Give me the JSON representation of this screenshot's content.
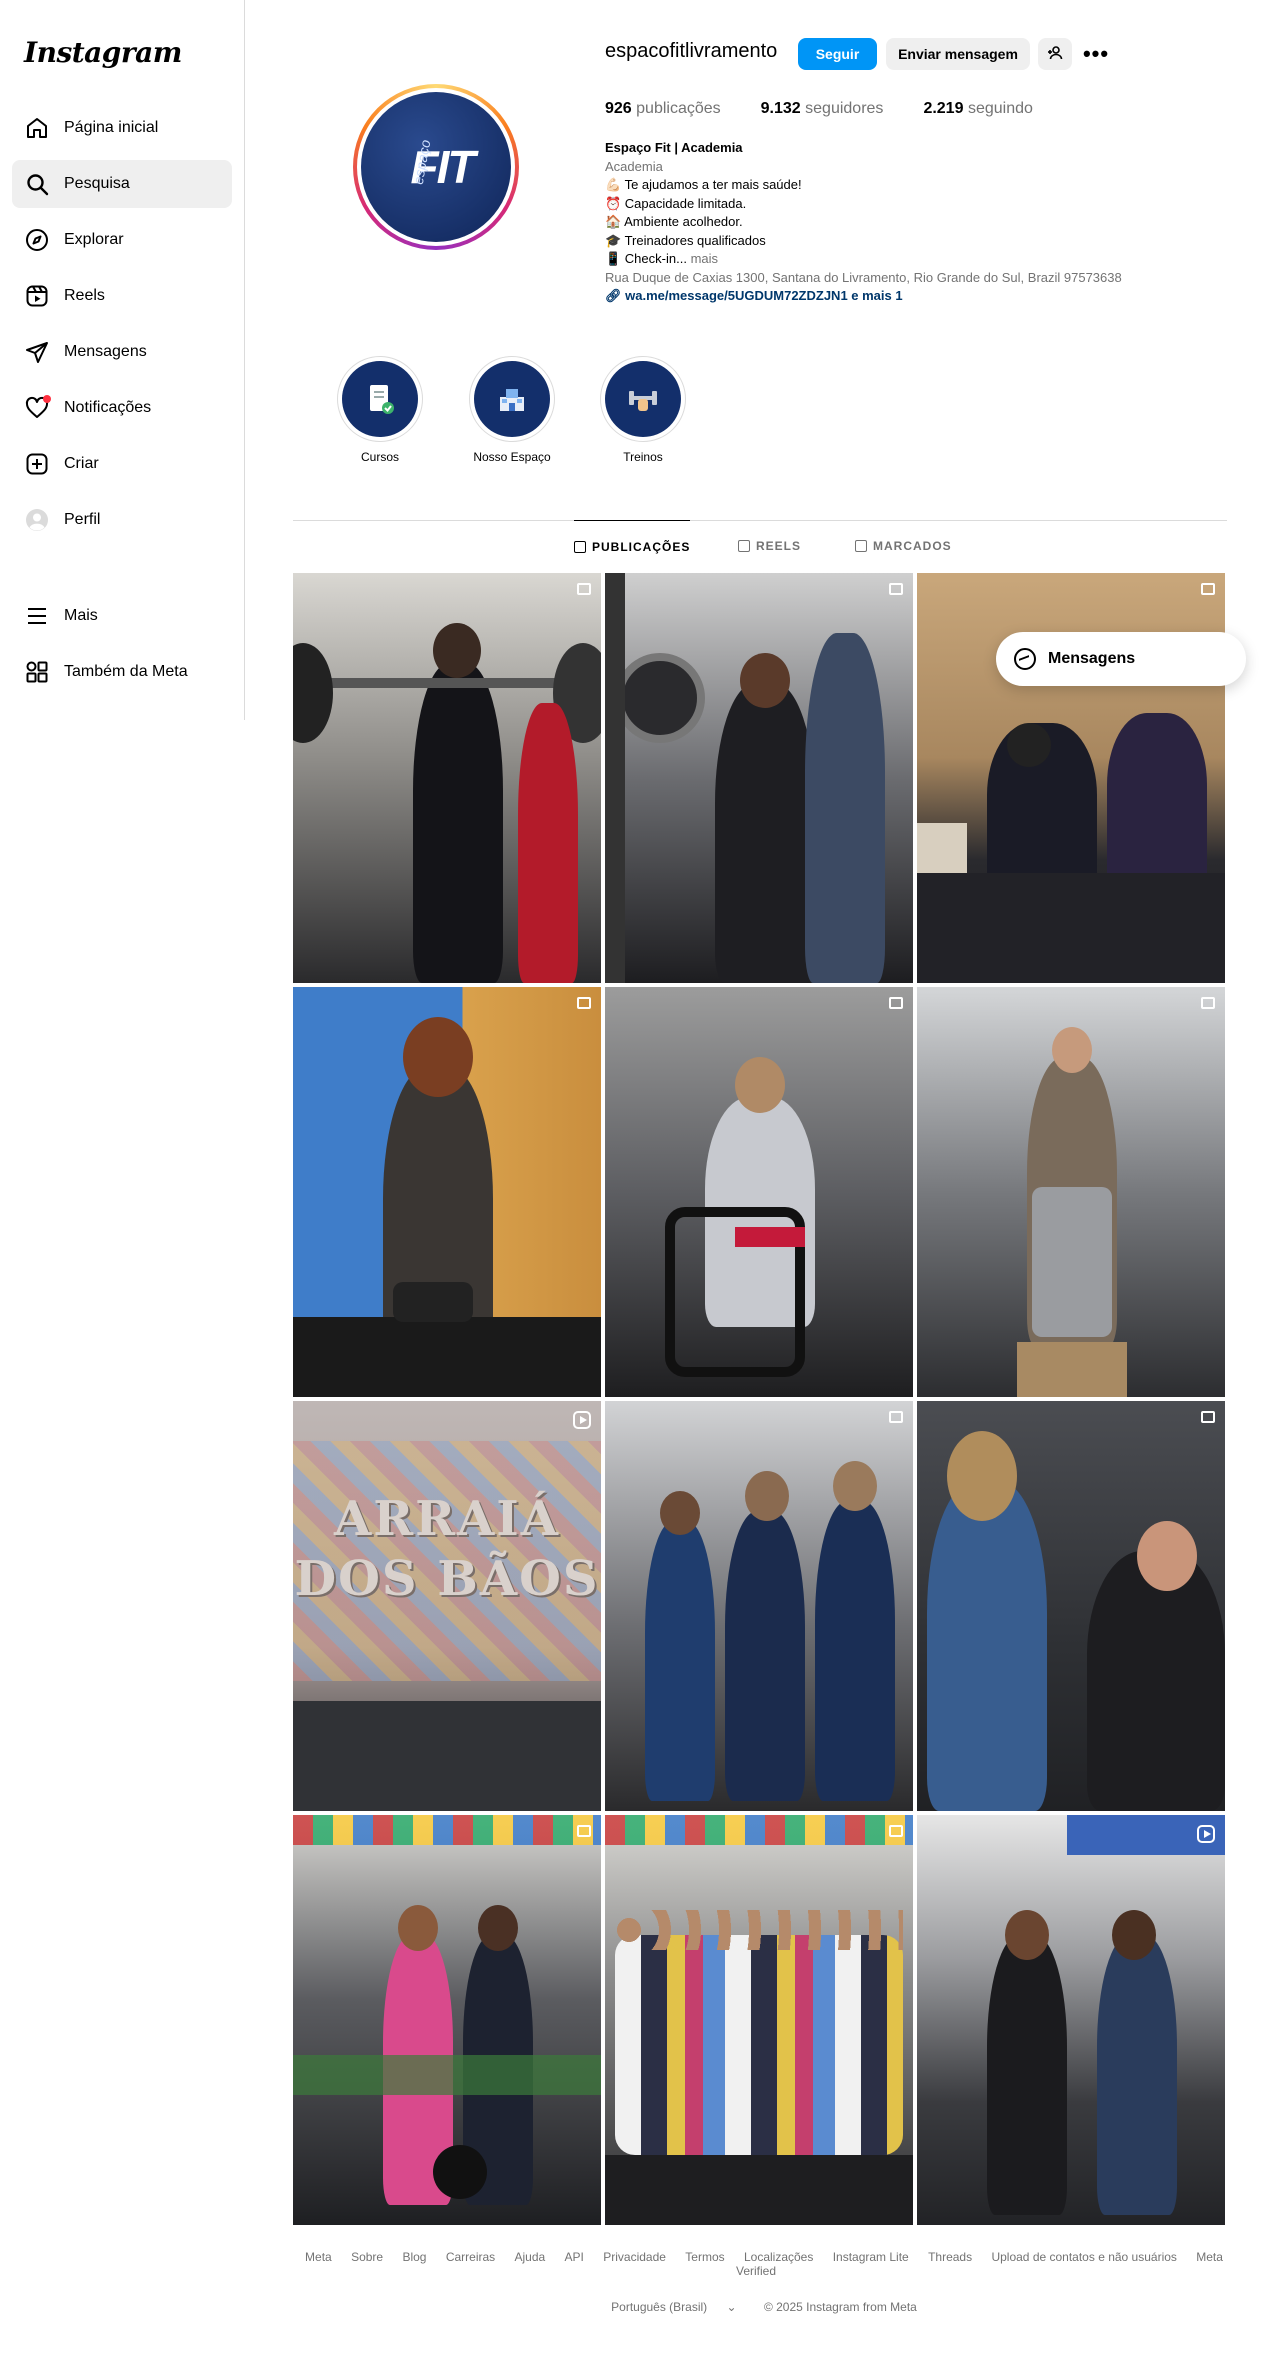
{
  "app": {
    "brand": "Instagram"
  },
  "sidebar": {
    "items": [
      {
        "label": "Página inicial",
        "icon": "home-icon"
      },
      {
        "label": "Pesquisa",
        "icon": "search-icon",
        "active": true
      },
      {
        "label": "Explorar",
        "icon": "compass-icon"
      },
      {
        "label": "Reels",
        "icon": "reels-icon"
      },
      {
        "label": "Mensagens",
        "icon": "send-icon"
      },
      {
        "label": "Notificações",
        "icon": "heart-icon"
      },
      {
        "label": "Criar",
        "icon": "plus-square-icon"
      },
      {
        "label": "Perfil",
        "icon": "profile-avatar-icon"
      }
    ],
    "bottom": [
      {
        "label": "Mais",
        "icon": "menu-icon"
      },
      {
        "label": "Também da Meta",
        "icon": "meta-apps-icon"
      }
    ]
  },
  "profile": {
    "username": "espacofitlivramento",
    "follow_label": "Seguir",
    "message_label": "Enviar mensagem",
    "avatar_text_small": "espaço",
    "avatar_text_big": "FIT",
    "stats": {
      "posts_count": "926",
      "posts_label": "publicações",
      "followers_count": "9.132",
      "followers_label": "seguidores",
      "following_count": "2.219",
      "following_label": "seguindo"
    },
    "bio": {
      "name": "Espaço Fit | Academia",
      "category": "Academia",
      "lines": [
        "💪🏻 Te ajudamos a ter mais saúde!",
        "⏰ Capacidade limitada.",
        "🏠 Ambiente acolhedor.",
        "🎓 Treinadores qualificados"
      ],
      "checkin": "📱 Check-in...",
      "more": "mais",
      "address": "Rua Duque de Caxias 1300, Santana do Livramento, Rio Grande do Sul, Brazil 97573638",
      "link": "wa.me/message/5UGDUM72ZDZJN1 e mais 1"
    }
  },
  "highlights": [
    {
      "label": "Cursos",
      "icon": "document-check-icon"
    },
    {
      "label": "Nosso Espaço",
      "icon": "gym-building-icon"
    },
    {
      "label": "Treinos",
      "icon": "dumbbell-icon"
    }
  ],
  "tabs": [
    {
      "label": "PUBLICAÇÕES",
      "active": true
    },
    {
      "label": "REELS"
    },
    {
      "label": "MARCADOS"
    }
  ],
  "posts": {
    "arraial_text_1": "ARRAIÁ",
    "arraial_text_2": "DOS BÃOS"
  },
  "float": {
    "label": "Mensagens"
  },
  "footer": {
    "links": [
      "Meta",
      "Sobre",
      "Blog",
      "Carreiras",
      "Ajuda",
      "API",
      "Privacidade",
      "Termos",
      "Localizações",
      "Instagram Lite",
      "Threads",
      "Upload de contatos e não usuários",
      "Meta Verified"
    ],
    "language": "Português (Brasil)",
    "copyright": "© 2025 Instagram from Meta"
  },
  "colors": {
    "accent": "#0095f6",
    "brand_navy": "#132f6b",
    "notification": "#ff3040"
  }
}
